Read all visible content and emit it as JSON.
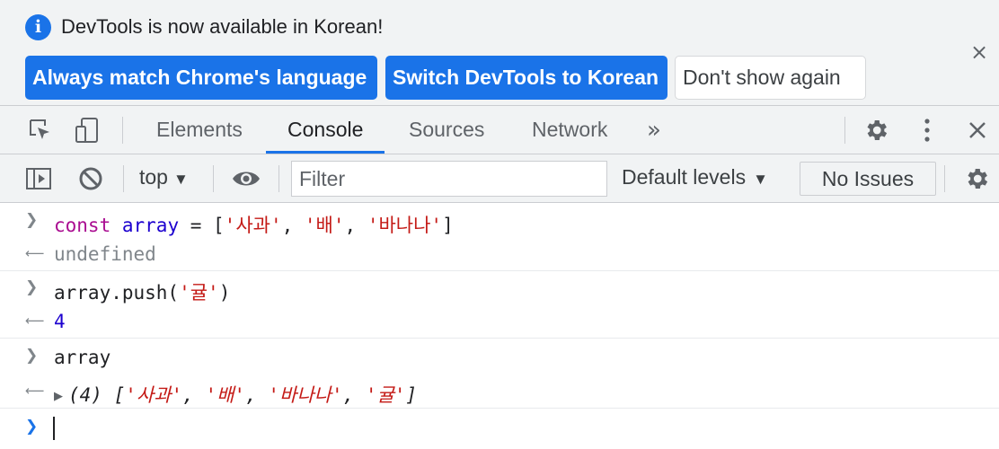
{
  "infobar": {
    "message": "DevTools is now available in Korean!",
    "buttons": {
      "match_language": "Always match Chrome's language",
      "switch_korean": "Switch DevTools to Korean",
      "dont_show": "Don't show again"
    },
    "close": "×"
  },
  "tabs": [
    "Elements",
    "Console",
    "Sources",
    "Network"
  ],
  "active_tab": "Console",
  "more_tabs": "»",
  "console_toolbar": {
    "context": "top",
    "filter_placeholder": "Filter",
    "levels": "Default levels",
    "issues": "No Issues"
  },
  "console": {
    "entries": [
      {
        "kind": "input",
        "text": "const array = ['사과', '배', '바나나']"
      },
      {
        "kind": "output",
        "text": "undefined"
      },
      {
        "kind": "input",
        "text": "array.push('귤')"
      },
      {
        "kind": "output",
        "text": "4"
      },
      {
        "kind": "input",
        "text": "array"
      },
      {
        "kind": "output",
        "text": "(4) ['사과', '배', '바나나', '귤']"
      }
    ],
    "tokens": {
      "kw_const": "const",
      "id_array": "array",
      "op_eq": " = [",
      "s1": "'사과'",
      "s2": "'배'",
      "s3": "'바나나'",
      "s4": "'귤'",
      "comma": ", ",
      "close": "]",
      "push_call": "array.push(",
      "push_close": ")",
      "undefined": "undefined",
      "four": "4",
      "array": "array",
      "count": "(4) ",
      "open": "["
    }
  },
  "colors": {
    "accent": "#1a73e8",
    "keyword": "#aa0d91",
    "identifier": "#1c00cf",
    "string": "#c41a16"
  }
}
